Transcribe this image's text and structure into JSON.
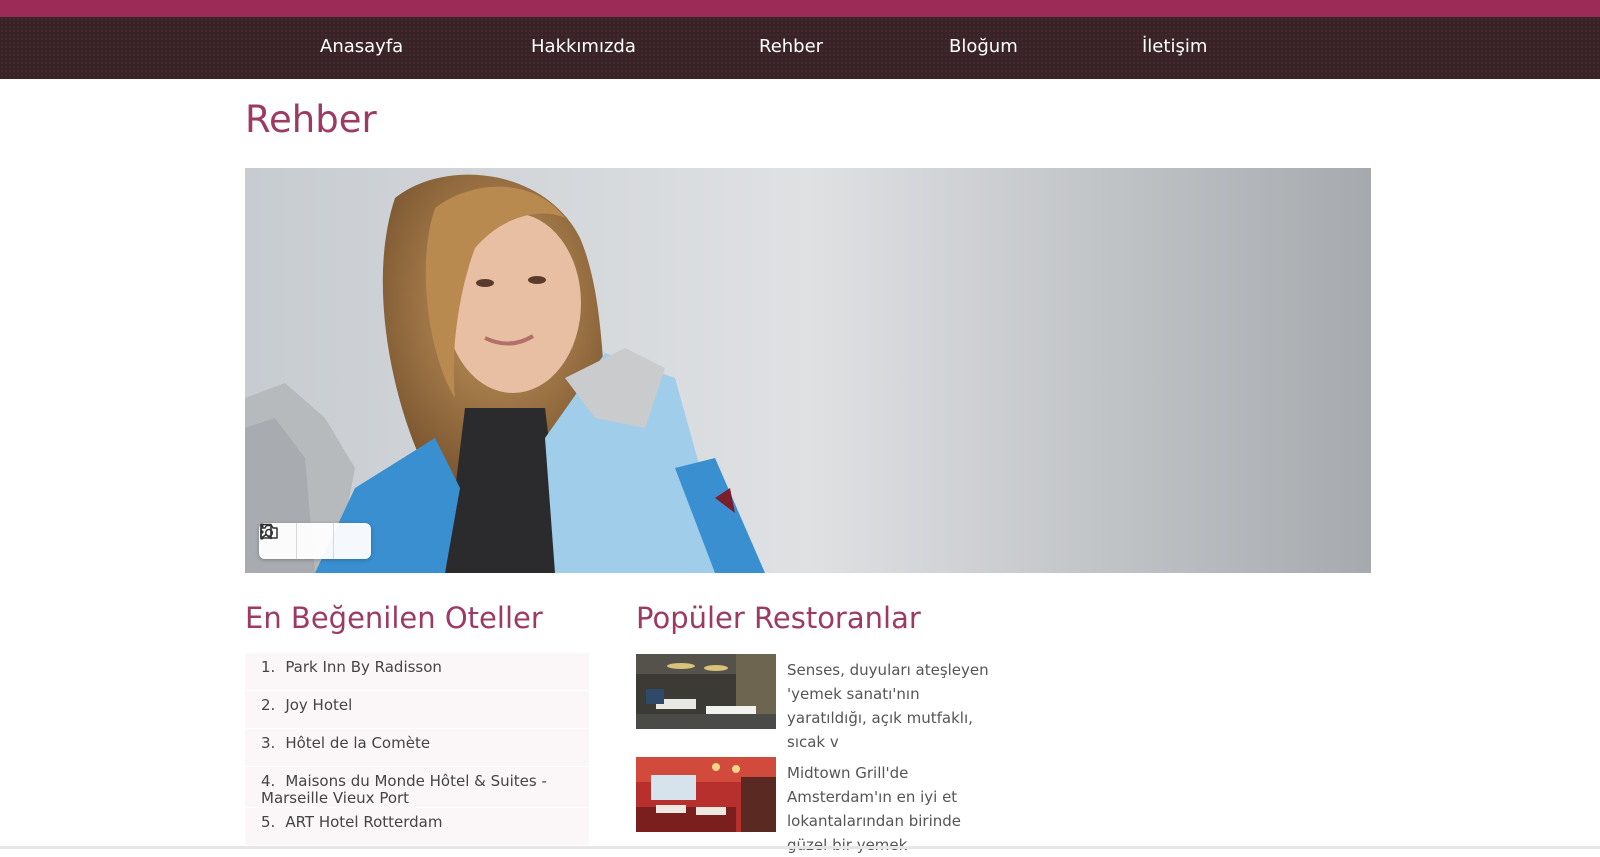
{
  "nav": {
    "items": [
      {
        "label": "Anasayfa"
      },
      {
        "label": "Hakkımızda"
      },
      {
        "label": "Rehber"
      },
      {
        "label": "Bloğum"
      },
      {
        "label": "İletişim"
      }
    ]
  },
  "page": {
    "title": "Rehber"
  },
  "hero": {
    "toolbar": {
      "icons": [
        "bookmark-icon",
        "camera-search-icon",
        "more-vertical-icon"
      ]
    }
  },
  "hotels": {
    "title": "En Beğenilen Oteller",
    "items": [
      {
        "num": "1.",
        "name": "Park Inn By Radisson"
      },
      {
        "num": "2.",
        "name": "Joy Hotel"
      },
      {
        "num": "3.",
        "name": "Hôtel de la Comète"
      },
      {
        "num": "4.",
        "name": "Maisons du Monde Hôtel & Suites - Marseille Vieux Port"
      },
      {
        "num": "5.",
        "name": "ART Hotel Rotterdam"
      }
    ]
  },
  "restaurants": {
    "title": "Popüler Restoranlar",
    "items": [
      {
        "text": "Senses, duyuları ateşleyen 'yemek sanatı'nın yaratıldığı, açık mutfaklı, sıcak v"
      },
      {
        "text": "Midtown Grill'de Amsterdam'ın en iyi et lokantalarından birinde güzel bir yemek"
      }
    ]
  },
  "colors": {
    "accent": "#9c2b58",
    "heading": "#9c3a63",
    "navbar": "#3a2326"
  }
}
